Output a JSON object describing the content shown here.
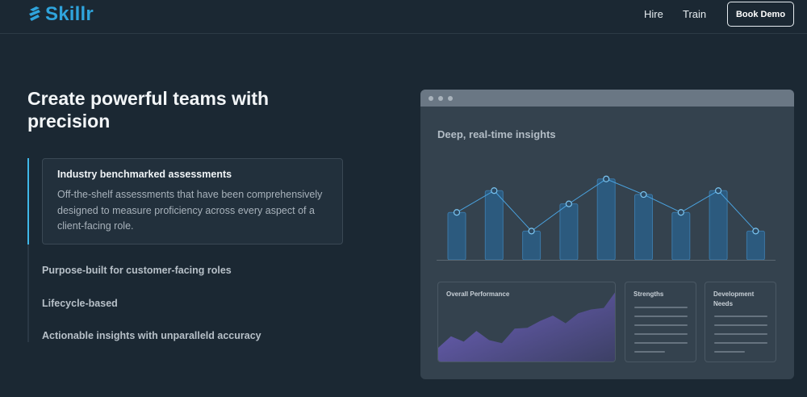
{
  "nav": {
    "brand": "Skillr",
    "links": [
      "Hire",
      "Train"
    ],
    "cta": "Book Demo"
  },
  "hero": {
    "headline": "Create powerful teams with precision",
    "features": [
      {
        "title": "Industry benchmarked assessments",
        "description": "Off-the-shelf assessments that have been comprehensively designed to measure proficiency across every aspect of a client-facing role.",
        "active": true
      },
      {
        "title": "Purpose-built for customer-facing roles"
      },
      {
        "title": "Lifecycle-based"
      },
      {
        "title": "Actionable insights with unparalleld accuracy"
      }
    ]
  },
  "preview": {
    "title": "Deep, real-time insights",
    "panels": {
      "performance": "Overall Performance",
      "strengths": "Strengths",
      "development": "Development Needs"
    }
  },
  "colors": {
    "background": "#1b2833",
    "brand": "#2fa4dc",
    "accent": "#3fb8e8",
    "bar_fill": "#2c5a7e",
    "line": "#4aa3e0",
    "area": "#6a5fb3"
  },
  "icons": {
    "logo": "skillr-logo-icon"
  },
  "chart_data": [
    {
      "type": "bar",
      "note_line": "line overlay connects bar tops",
      "values": [
        61,
        89,
        37,
        72,
        104,
        84,
        61,
        89,
        37
      ]
    },
    {
      "type": "area",
      "values": [
        20,
        35,
        28,
        42,
        30,
        26,
        45,
        46,
        55,
        62,
        52,
        65,
        70,
        72,
        95
      ]
    }
  ]
}
